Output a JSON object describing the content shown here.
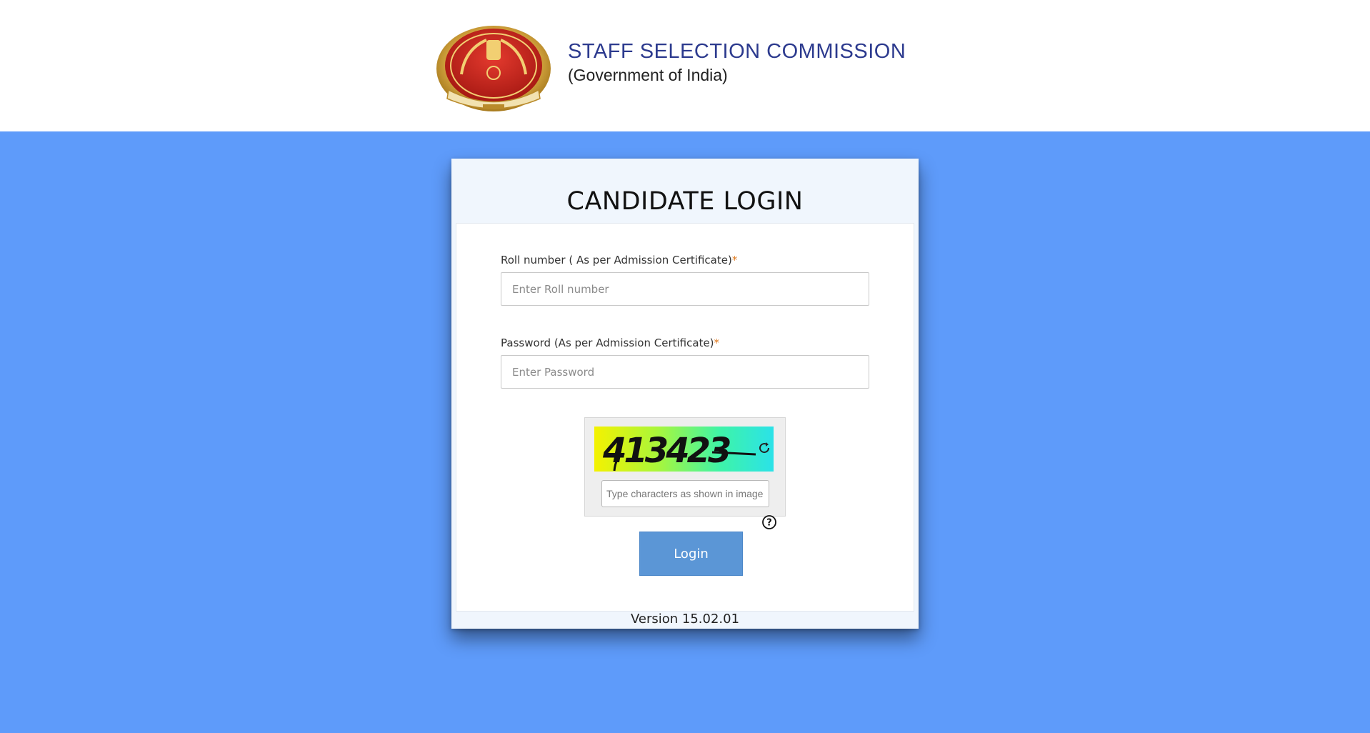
{
  "header": {
    "org_name": "STAFF SELECTION COMMISSION",
    "org_subtitle": "(Government of India)",
    "logo_icon": "ssc-emblem-logo"
  },
  "login": {
    "title": "CANDIDATE LOGIN",
    "roll_label": "Roll number ( As per Admission Certificate)",
    "roll_placeholder": "Enter Roll number",
    "roll_value": "",
    "password_label": "Password (As per Admission Certificate)",
    "password_placeholder": "Enter Password",
    "password_value": "",
    "required_mark": "*",
    "captcha_text": "413423",
    "captcha_placeholder": "Type characters as shown in image",
    "captcha_value": "",
    "refresh_icon": "refresh-icon",
    "help_icon": "help-icon",
    "help_symbol": "?",
    "login_button": "Login",
    "version": "Version 15.02.01"
  },
  "colors": {
    "page_background": "#5e9bfa",
    "header_text": "#2c3a8e",
    "button": "#5b96d6",
    "required": "#e07a1f"
  }
}
